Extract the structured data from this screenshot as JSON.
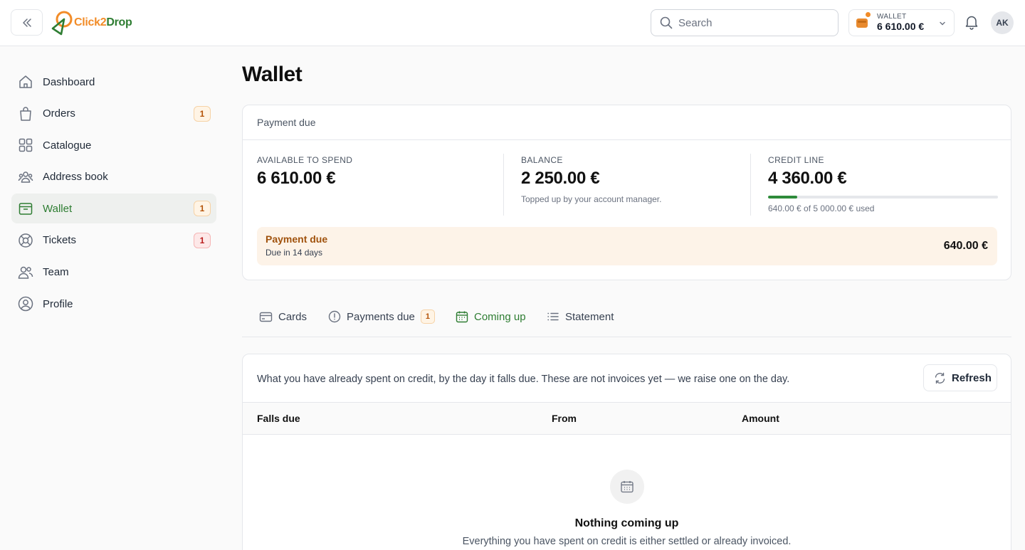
{
  "app": {
    "logo_text_part1": "Click2",
    "logo_text_part2": "Drop"
  },
  "header": {
    "search_placeholder": "Search",
    "wallet_label": "WALLET",
    "wallet_amount": "6 610.00 €",
    "avatar_initials": "AK"
  },
  "sidebar": {
    "items": [
      {
        "label": "Dashboard",
        "icon": "home-icon",
        "badge": ""
      },
      {
        "label": "Orders",
        "icon": "shopping-bag-icon",
        "badge": "1"
      },
      {
        "label": "Catalogue",
        "icon": "grid-icon",
        "badge": ""
      },
      {
        "label": "Address book",
        "icon": "users-group-icon",
        "badge": ""
      },
      {
        "label": "Wallet",
        "icon": "wallet-icon",
        "badge": "1",
        "active": true
      },
      {
        "label": "Tickets",
        "icon": "lifebuoy-icon",
        "badge": "1"
      },
      {
        "label": "Team",
        "icon": "team-icon",
        "badge": ""
      },
      {
        "label": "Profile",
        "icon": "user-circle-icon",
        "badge": ""
      }
    ]
  },
  "page": {
    "title": "Wallet"
  },
  "summary": {
    "header": "Payment due",
    "available_label": "AVAILABLE TO SPEND",
    "available_value": "6 610.00 €",
    "balance_label": "BALANCE",
    "balance_value": "2 250.00 €",
    "balance_note": "Topped up by your account manager.",
    "credit_label": "CREDIT LINE",
    "credit_value": "4 360.00 €",
    "credit_used_fraction": 0.128,
    "credit_note": "640.00 € of 5 000.00 € used",
    "due_title": "Payment due",
    "due_sub": "Due in 14 days",
    "due_amount": "640.00 €"
  },
  "tabs": [
    {
      "label": "Cards",
      "icon": "card-icon"
    },
    {
      "label": "Payments due",
      "icon": "alert-circle-icon",
      "badge": "1"
    },
    {
      "label": "Coming up",
      "icon": "calendar-icon",
      "active": true
    },
    {
      "label": "Statement",
      "icon": "list-icon"
    }
  ],
  "upcoming": {
    "description": "What you have already spent on credit, by the day it falls due. These are not invoices yet — we raise one on the day.",
    "refresh_label": "Refresh",
    "columns": [
      "Falls due",
      "From",
      "Amount"
    ],
    "empty_title": "Nothing coming up",
    "empty_sub": "Everything you have spent on credit is either settled or already invoiced."
  },
  "colors": {
    "brand_green": "#2e7d32",
    "brand_orange": "#f28c28",
    "due_bg": "#fdf3e8"
  }
}
